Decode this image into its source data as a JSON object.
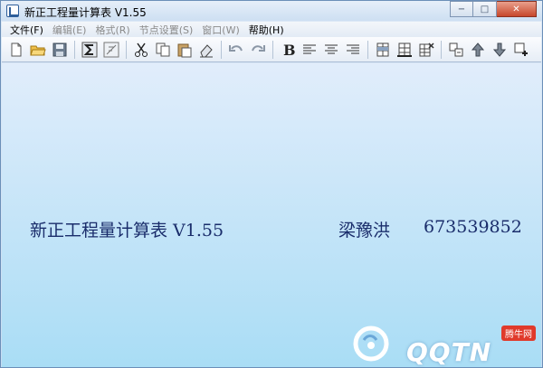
{
  "window": {
    "title": "新正工程量计算表 V1.55",
    "controls": {
      "minimize": "−",
      "maximize": "□",
      "close": "✕"
    }
  },
  "menu": [
    {
      "label": "文件(F)",
      "enabled": true
    },
    {
      "label": "编辑(E)",
      "enabled": false
    },
    {
      "label": "格式(R)",
      "enabled": false
    },
    {
      "label": "节点设置(S)",
      "enabled": false
    },
    {
      "label": "窗口(W)",
      "enabled": false
    },
    {
      "label": "帮助(H)",
      "enabled": true
    }
  ],
  "toolbar": {
    "groups": [
      [
        "new-file-icon",
        "open-folder-icon",
        "save-icon"
      ],
      [
        "sum-icon",
        "formula-icon"
      ],
      [
        "cut-icon",
        "copy-icon",
        "paste-icon",
        "eraser-icon"
      ],
      [
        "undo-icon",
        "redo-icon"
      ],
      [
        "bold-icon",
        "align-left-icon",
        "align-center-icon",
        "align-right-icon"
      ],
      [
        "insert-row-icon",
        "insert-column-icon",
        "delete-cells-icon"
      ],
      [
        "add-node-icon",
        "move-up-icon",
        "move-down-icon",
        "append-node-icon"
      ]
    ]
  },
  "banner": {
    "app_name": "新正工程量计算表 V1.55",
    "author": "梁豫洪",
    "qq": "673539852"
  },
  "watermark": {
    "brand": "QQTN",
    "badge": "腾牛网"
  },
  "colors": {
    "banner_text": "#1a2d6b",
    "client_top": "#e1edfb",
    "client_bottom": "#a9ddf5",
    "close_button": "#c7472b"
  }
}
